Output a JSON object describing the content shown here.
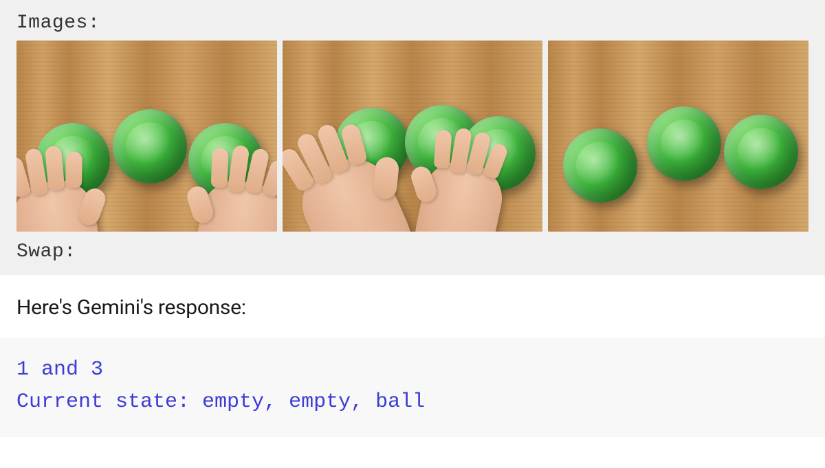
{
  "prompt": {
    "images_label": "Images:",
    "swap_label": "Swap:"
  },
  "narrative": "Here's Gemini's response:",
  "response": {
    "line1": "1 and 3",
    "line2": "Current state: empty, empty, ball"
  },
  "figure": {
    "description": "Three sequential video frames of a cup-shuffle game on a wooden surface with three green cups.",
    "frames": [
      {
        "index": 1,
        "cups": 3,
        "hands": "Two hands reaching from bottom: left hand gripping leftmost cup, right hand gripping rightmost cup.",
        "note": "Before swap — cups in positions 1, 2, 3."
      },
      {
        "index": 2,
        "cups": 3,
        "hands": "Two hands crossing near center, mid-swap, manipulating cups around the middle/right region.",
        "note": "During swap — hands moving cups 1 and 3 past each other."
      },
      {
        "index": 3,
        "cups": 3,
        "hands": "No hands visible.",
        "note": "After swap — three cups at rest, leftmost cup slightly tilted."
      }
    ]
  }
}
